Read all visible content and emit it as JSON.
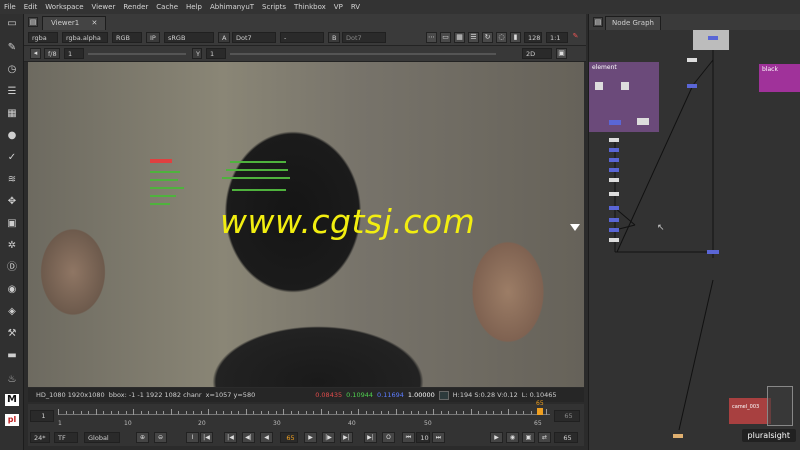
{
  "menu": [
    "File",
    "Edit",
    "Workspace",
    "Viewer",
    "Render",
    "Cache",
    "Help",
    "AbhimanyuT",
    "Scripts",
    "Thinkbox",
    "VP",
    "RV"
  ],
  "viewer": {
    "tab_label": "Viewer1",
    "channels": "rgba",
    "alpha": "rgba.alpha",
    "colorspace": "RGB",
    "ip": "IP",
    "lut": "sRGB",
    "a_label": "A",
    "a_input": "Dot7",
    "compare": "-",
    "b_label": "B",
    "b_input": "Dot7",
    "zoom": "128",
    "ratio": "1:1",
    "fstop": "f/8",
    "gain": "1",
    "y_label": "Y",
    "gamma": "1",
    "view_mode": "2D"
  },
  "watermark": "www.cgtsj.com",
  "info": {
    "format": "HD_1080 1920x1080",
    "bbox": "bbox: -1 -1 1922 1082 chanr",
    "coords": "x=1057 y=580",
    "r": "0.08435",
    "g": "0.10944",
    "b": "0.11694",
    "a": "1.00000",
    "hsv": "H:194 S:0.28 V:0.12",
    "lum": "L: 0.10465",
    "colors": {
      "r": "#e04b4b",
      "g": "#4fd04f",
      "b": "#5c7cff"
    }
  },
  "timeline": {
    "start": "1",
    "end": "65",
    "ticks": [
      "1",
      "10",
      "20",
      "30",
      "40",
      "50",
      "65"
    ],
    "current": "65",
    "fps": "24*",
    "tf": "TF",
    "scope": "Global",
    "step": "10",
    "end_frame": "65"
  },
  "nodegraph": {
    "tab_label": "Node Graph",
    "backdrop1_label": "element",
    "backdrop2_label": "black",
    "backdrop3_label": "camel_003",
    "backdrop_colors": {
      "purple": "#6b4a7a",
      "magenta": "#a0329a",
      "red": "#a84040"
    },
    "brand": "pluralsight"
  }
}
